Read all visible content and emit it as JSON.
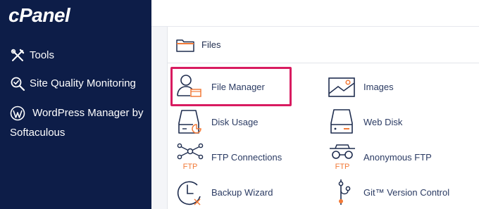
{
  "brand": "cPanel",
  "sidebar": {
    "items": [
      {
        "label": "Tools",
        "icon": "tools-icon"
      },
      {
        "label": "Site Quality Monitoring",
        "icon": "magnifier-check-icon"
      },
      {
        "label": "WordPress Manager by Softaculous",
        "icon": "wordpress-icon"
      }
    ]
  },
  "section": {
    "title": "Files",
    "icon": "folder-icon"
  },
  "tools": [
    {
      "label": "File Manager",
      "icon": "file-manager-icon"
    },
    {
      "label": "Images",
      "icon": "images-icon"
    },
    {
      "label": "Disk Usage",
      "icon": "disk-usage-icon"
    },
    {
      "label": "Web Disk",
      "icon": "web-disk-icon"
    },
    {
      "label": "FTP Connections",
      "icon": "ftp-connections-icon",
      "badge": "FTP"
    },
    {
      "label": "Anonymous FTP",
      "icon": "anonymous-ftp-icon",
      "badge": "FTP"
    },
    {
      "label": "Backup Wizard",
      "icon": "backup-wizard-icon"
    },
    {
      "label": "Git™ Version Control",
      "icon": "git-icon"
    }
  ],
  "colors": {
    "sidebar_bg": "#0d1d48",
    "accent_orange": "#f27a38",
    "highlight": "#d81b60",
    "icon_dark": "#1f2d4f",
    "link_text": "#2b3b63"
  }
}
